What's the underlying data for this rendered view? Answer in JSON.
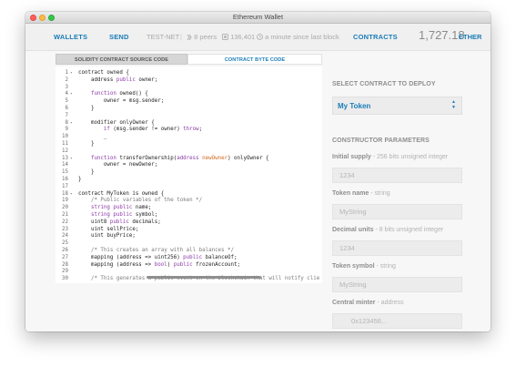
{
  "window": {
    "title": "Ethereum Wallet"
  },
  "nav": {
    "wallets": "WALLETS",
    "send": "SEND",
    "network": "TEST-NET",
    "sep": "|",
    "peers": "8 peers",
    "block": "136,401",
    "time": "a minute since last block",
    "contracts": "CONTRACTS",
    "balance": "1,727.18",
    "unit": "ETHER"
  },
  "tabs": {
    "source": "SOLIDITY CONTRACT SOURCE CODE",
    "bytecode": "CONTRACT BYTE CODE"
  },
  "code_lines": [
    {
      "n": "1",
      "fold": "▾",
      "parts": [
        {
          "t": "contract owned {",
          "c": ""
        }
      ]
    },
    {
      "n": "2",
      "fold": "",
      "parts": [
        {
          "t": "    address ",
          "c": ""
        },
        {
          "t": "public",
          "c": "kw"
        },
        {
          "t": " owner;",
          "c": ""
        }
      ]
    },
    {
      "n": "3",
      "fold": "",
      "parts": [
        {
          "t": "",
          "c": ""
        }
      ]
    },
    {
      "n": "4",
      "fold": "▾",
      "parts": [
        {
          "t": "    ",
          "c": ""
        },
        {
          "t": "function",
          "c": "kw"
        },
        {
          "t": " owned() {",
          "c": ""
        }
      ]
    },
    {
      "n": "5",
      "fold": "",
      "parts": [
        {
          "t": "        owner = msg.sender;",
          "c": ""
        }
      ]
    },
    {
      "n": "6",
      "fold": "",
      "parts": [
        {
          "t": "    }",
          "c": ""
        }
      ]
    },
    {
      "n": "7",
      "fold": "",
      "parts": [
        {
          "t": "",
          "c": ""
        }
      ]
    },
    {
      "n": "8",
      "fold": "▾",
      "parts": [
        {
          "t": "    modifier onlyOwner {",
          "c": ""
        }
      ]
    },
    {
      "n": "9",
      "fold": "",
      "parts": [
        {
          "t": "        ",
          "c": ""
        },
        {
          "t": "if",
          "c": "kw"
        },
        {
          "t": " (msg.sender != owner) ",
          "c": ""
        },
        {
          "t": "throw",
          "c": "kw"
        },
        {
          "t": ";",
          "c": ""
        }
      ]
    },
    {
      "n": "10",
      "fold": "",
      "parts": [
        {
          "t": "        _",
          "c": ""
        }
      ]
    },
    {
      "n": "11",
      "fold": "",
      "parts": [
        {
          "t": "    }",
          "c": ""
        }
      ]
    },
    {
      "n": "12",
      "fold": "",
      "parts": [
        {
          "t": "",
          "c": ""
        }
      ]
    },
    {
      "n": "13",
      "fold": "▾",
      "parts": [
        {
          "t": "    ",
          "c": ""
        },
        {
          "t": "function",
          "c": "kw"
        },
        {
          "t": " transferOwnership(",
          "c": ""
        },
        {
          "t": "address",
          "c": "kw"
        },
        {
          "t": " ",
          "c": ""
        },
        {
          "t": "newOwner",
          "c": "var"
        },
        {
          "t": ") onlyOwner {",
          "c": ""
        }
      ]
    },
    {
      "n": "14",
      "fold": "",
      "parts": [
        {
          "t": "        owner = newOwner;",
          "c": ""
        }
      ]
    },
    {
      "n": "15",
      "fold": "",
      "parts": [
        {
          "t": "    }",
          "c": ""
        }
      ]
    },
    {
      "n": "16",
      "fold": "",
      "parts": [
        {
          "t": "}",
          "c": ""
        }
      ]
    },
    {
      "n": "17",
      "fold": "",
      "parts": [
        {
          "t": "",
          "c": ""
        }
      ]
    },
    {
      "n": "18",
      "fold": "▾",
      "parts": [
        {
          "t": "contract MyToken is owned {",
          "c": ""
        }
      ]
    },
    {
      "n": "19",
      "fold": "",
      "parts": [
        {
          "t": "    /* Public variables of the token */",
          "c": "cm"
        }
      ]
    },
    {
      "n": "20",
      "fold": "",
      "parts": [
        {
          "t": "    ",
          "c": ""
        },
        {
          "t": "string",
          "c": "kw"
        },
        {
          "t": " ",
          "c": ""
        },
        {
          "t": "public",
          "c": "kw"
        },
        {
          "t": " name;",
          "c": ""
        }
      ]
    },
    {
      "n": "21",
      "fold": "",
      "parts": [
        {
          "t": "    ",
          "c": ""
        },
        {
          "t": "string",
          "c": "kw"
        },
        {
          "t": " ",
          "c": ""
        },
        {
          "t": "public",
          "c": "kw"
        },
        {
          "t": " symbol;",
          "c": ""
        }
      ]
    },
    {
      "n": "22",
      "fold": "",
      "parts": [
        {
          "t": "    uint8 ",
          "c": ""
        },
        {
          "t": "public",
          "c": "kw"
        },
        {
          "t": " decimals;",
          "c": ""
        }
      ]
    },
    {
      "n": "23",
      "fold": "",
      "parts": [
        {
          "t": "    uint sellPrice;",
          "c": ""
        }
      ]
    },
    {
      "n": "24",
      "fold": "",
      "parts": [
        {
          "t": "    uint buyPrice;",
          "c": ""
        }
      ]
    },
    {
      "n": "25",
      "fold": "",
      "parts": [
        {
          "t": "",
          "c": ""
        }
      ]
    },
    {
      "n": "26",
      "fold": "",
      "parts": [
        {
          "t": "    /* This creates an array with all balances */",
          "c": "cm"
        }
      ]
    },
    {
      "n": "27",
      "fold": "",
      "parts": [
        {
          "t": "    mapping (address => uint256) ",
          "c": ""
        },
        {
          "t": "public",
          "c": "kw"
        },
        {
          "t": " balanceOf;",
          "c": ""
        }
      ]
    },
    {
      "n": "28",
      "fold": "",
      "parts": [
        {
          "t": "    mapping (address => ",
          "c": ""
        },
        {
          "t": "bool",
          "c": "kw"
        },
        {
          "t": ") ",
          "c": ""
        },
        {
          "t": "public",
          "c": "kw"
        },
        {
          "t": " frozenAccount;",
          "c": ""
        }
      ]
    },
    {
      "n": "29",
      "fold": "",
      "parts": [
        {
          "t": "",
          "c": ""
        }
      ]
    },
    {
      "n": "30",
      "fold": "",
      "parts": [
        {
          "t": "    /* This generates a public event on the blockchain that will notify clie",
          "c": "cm"
        }
      ]
    }
  ],
  "sidebar": {
    "select_heading": "SELECT CONTRACT TO DEPLOY",
    "selected_contract": "My Token",
    "select_arrows": "▲▼",
    "params_heading": "CONSTRUCTOR PARAMETERS",
    "params": [
      {
        "label": "Initial supply",
        "hint": " - 256 bits unsigned integer",
        "placeholder": "1234"
      },
      {
        "label": "Token name",
        "hint": " - string",
        "placeholder": "MyString"
      },
      {
        "label": "Decimal units",
        "hint": " - 8 bits unsigned integer",
        "placeholder": "1234"
      },
      {
        "label": "Token symbol",
        "hint": " - string",
        "placeholder": "MyString"
      },
      {
        "label": "Central minter",
        "hint": " - address",
        "placeholder": "0x123456..."
      }
    ]
  },
  "colors": {
    "accent": "#1a7cb8",
    "keyword": "#8a3aa8",
    "param": "#d2691e"
  },
  "icons": {
    "peers": "peers-icon",
    "block": "block-icon",
    "clock": "clock-icon"
  }
}
